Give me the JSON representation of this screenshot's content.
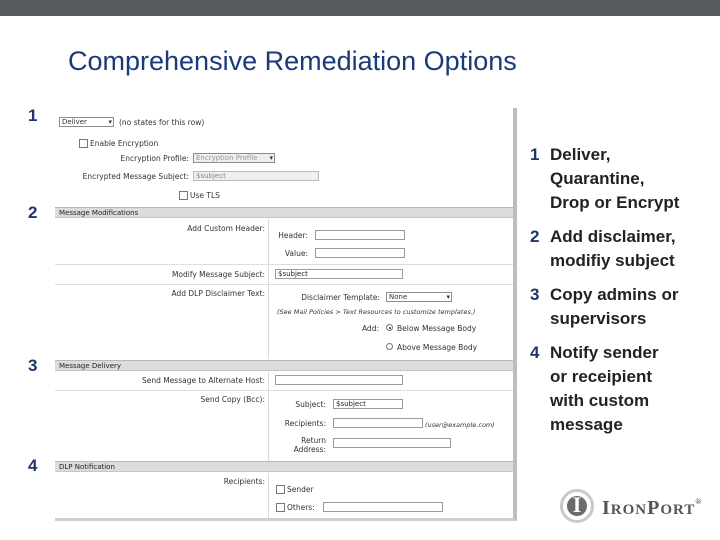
{
  "slide": {
    "title": "Comprehensive Remediation Options",
    "markers": [
      "1",
      "2",
      "3",
      "4"
    ]
  },
  "screenshot": {
    "action": {
      "select_value": "Deliver",
      "note": "(no states for this row)"
    },
    "encryption": {
      "enable_label": "Enable Encryption",
      "profile_label": "Encryption Profile:",
      "profile_value": "Encryption Profile",
      "subject_label": "Encrypted Message Subject:",
      "subject_value": "$subject",
      "use_tls_label": "Use TLS"
    },
    "message_modifications": {
      "section_title": "Message Modifications",
      "add_header_label": "Add Custom Header:",
      "header_label": "Header:",
      "value_label": "Value:",
      "modify_subject_label": "Modify Message Subject:",
      "subject_value": "$subject",
      "disclaimer_label": "Add DLP Disclaimer Text:",
      "template_label": "Disclaimer Template:",
      "template_value": "None",
      "hint": "(See Mail Policies > Text Resources to customize templates.)",
      "add_label": "Add:",
      "below_label": "Below Message Body",
      "above_label": "Above Message Body"
    },
    "message_delivery": {
      "section_title": "Message Delivery",
      "alt_host_label": "Send Message to Alternate Host:",
      "send_copy_label": "Send Copy (Bcc):",
      "subject_label": "Subject:",
      "subject_value": "$subject",
      "recipients_label": "Recipients:",
      "recipients_hint": "(user@example.com)",
      "return_label": "Return",
      "address_label": "Address:"
    },
    "dlp_notification": {
      "section_title": "DLP Notification",
      "recipients_label": "Recipients:",
      "sender_label": "Sender",
      "others_label": "Others:"
    }
  },
  "bullets": [
    {
      "num": "1",
      "lines": [
        "Deliver,",
        "Quarantine,",
        "Drop or Encrypt"
      ]
    },
    {
      "num": "2",
      "lines": [
        "Add disclaimer,",
        "modifiy subject"
      ]
    },
    {
      "num": "3",
      "lines": [
        "Copy admins or",
        "supervisors"
      ]
    },
    {
      "num": "4",
      "lines": [
        "Notify sender",
        "or receipient",
        "with custom",
        "message"
      ]
    }
  ],
  "logo": {
    "glyph": "I",
    "text_1": "I",
    "text_2": "RON",
    "text_3": "P",
    "text_4": "ORT",
    "mark": "®"
  },
  "colors": {
    "title": "#1a3a7a",
    "marker": "#1f3566",
    "top_bar": "#555a5f"
  }
}
